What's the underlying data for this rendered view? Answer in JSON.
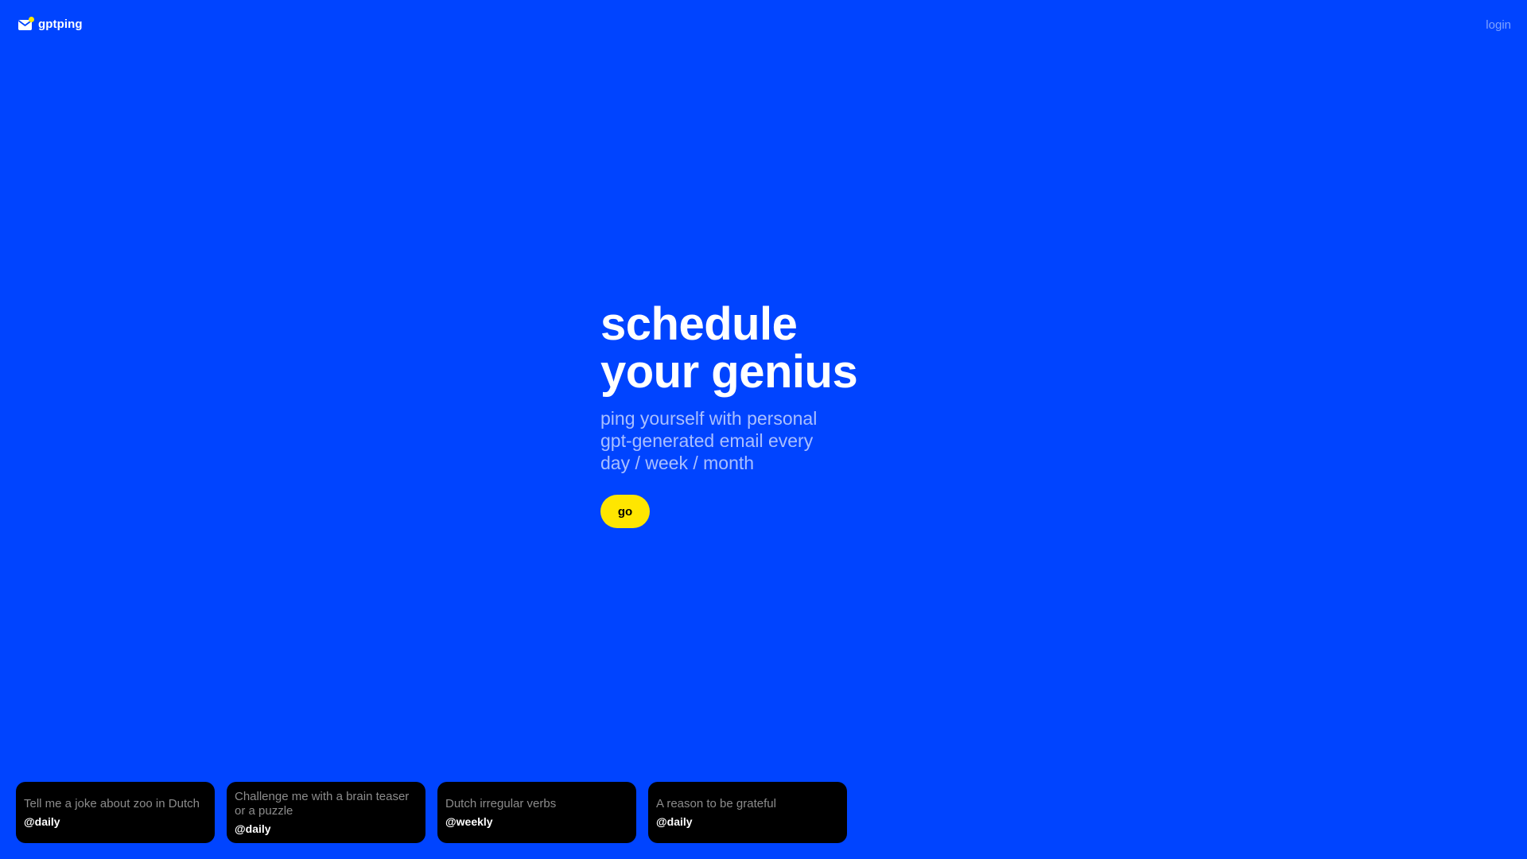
{
  "header": {
    "brand_name": "gptping",
    "brand_icon": "envelope-icon",
    "login_label": "login"
  },
  "hero": {
    "title_line1": "schedule",
    "title_line2": "your genius",
    "subtitle": "ping yourself with personal gpt-generated email every day / week / month",
    "go_label": "go"
  },
  "cards": [
    {
      "prompt": "Tell me a joke about zoo in Dutch",
      "frequency": "@daily"
    },
    {
      "prompt": "Challenge me with a brain teaser or a puzzle",
      "frequency": "@daily"
    },
    {
      "prompt": "Dutch irregular verbs",
      "frequency": "@weekly"
    },
    {
      "prompt": "A reason to be grateful",
      "frequency": "@daily"
    }
  ],
  "colors": {
    "background": "#0044ff",
    "accent_button": "#ffe600",
    "card_background": "#000000",
    "subtitle": "#a9bfff",
    "login": "#7fa2ff"
  }
}
